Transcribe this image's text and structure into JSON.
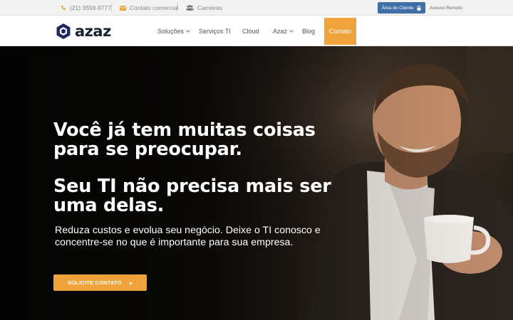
{
  "topbar": {
    "phone": "(21) 3559-9777",
    "contact": "Contato comercial",
    "careers": "Carreiras",
    "client_area": "Área do Cliente",
    "remote": "Acesso Remoto"
  },
  "header": {
    "logo_text": "azaz",
    "nav": {
      "solutions": "Soluções",
      "it_services": "Serviços TI",
      "cloud": "Cloud",
      "azaz": "Azaz",
      "blog": "Blog",
      "contact": "Contato"
    }
  },
  "hero": {
    "headline_1a": "Você já tem muitas coisas",
    "headline_1b": "para se preocupar.",
    "headline_2a": "Seu TI não precisa mais ser",
    "headline_2b": "uma delas.",
    "subtext": "Reduza custos e evolua seu negócio. Deixe o TI conosco e concentre-se no que é importante para sua empresa.",
    "cta": "SOLICITE CONTATO",
    "cta_arrows": "»"
  },
  "colors": {
    "accent_orange": "#f0a33a",
    "client_blue": "#3f6fa9",
    "logo_navy": "#1b2235"
  }
}
